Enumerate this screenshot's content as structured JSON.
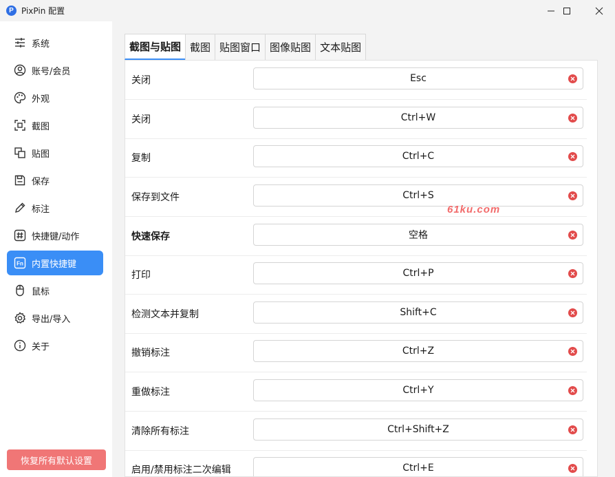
{
  "window": {
    "title": "PixPin 配置",
    "logo_letter": "P"
  },
  "sidebar": {
    "items": [
      {
        "label": "系统",
        "icon": "sliders-icon"
      },
      {
        "label": "账号/会员",
        "icon": "user-icon"
      },
      {
        "label": "外观",
        "icon": "palette-icon"
      },
      {
        "label": "截图",
        "icon": "screenshot-icon"
      },
      {
        "label": "贴图",
        "icon": "pin-icon"
      },
      {
        "label": "保存",
        "icon": "save-icon"
      },
      {
        "label": "标注",
        "icon": "pen-icon"
      },
      {
        "label": "快捷键/动作",
        "icon": "hashtag-icon"
      },
      {
        "label": "内置快捷键",
        "icon": "fn-key-icon",
        "active": true
      },
      {
        "label": "鼠标",
        "icon": "mouse-icon"
      },
      {
        "label": "导出/导入",
        "icon": "gear-icon"
      },
      {
        "label": "关于",
        "icon": "info-icon"
      }
    ],
    "reset_label": "恢复所有默认设置"
  },
  "tabs": [
    {
      "label": "截图与贴图",
      "active": true
    },
    {
      "label": "截图"
    },
    {
      "label": "贴图窗口"
    },
    {
      "label": "图像贴图"
    },
    {
      "label": "文本贴图"
    }
  ],
  "shortcuts": [
    {
      "action": "关闭",
      "key": "Esc"
    },
    {
      "action": "关闭",
      "key": "Ctrl+W"
    },
    {
      "action": "复制",
      "key": "Ctrl+C"
    },
    {
      "action": "保存到文件",
      "key": "Ctrl+S"
    },
    {
      "action": "快速保存",
      "key": "空格",
      "bold": true
    },
    {
      "action": "打印",
      "key": "Ctrl+P"
    },
    {
      "action": "检测文本并复制",
      "key": "Shift+C"
    },
    {
      "action": "撤销标注",
      "key": "Ctrl+Z"
    },
    {
      "action": "重做标注",
      "key": "Ctrl+Y"
    },
    {
      "action": "清除所有标注",
      "key": "Ctrl+Shift+Z"
    },
    {
      "action": "启用/禁用标注二次编辑",
      "key": "Ctrl+E"
    }
  ],
  "watermark": "61ku.com",
  "colors": {
    "accent": "#3a8ef6",
    "danger": "#e24b4b",
    "reset": "#f07676"
  }
}
